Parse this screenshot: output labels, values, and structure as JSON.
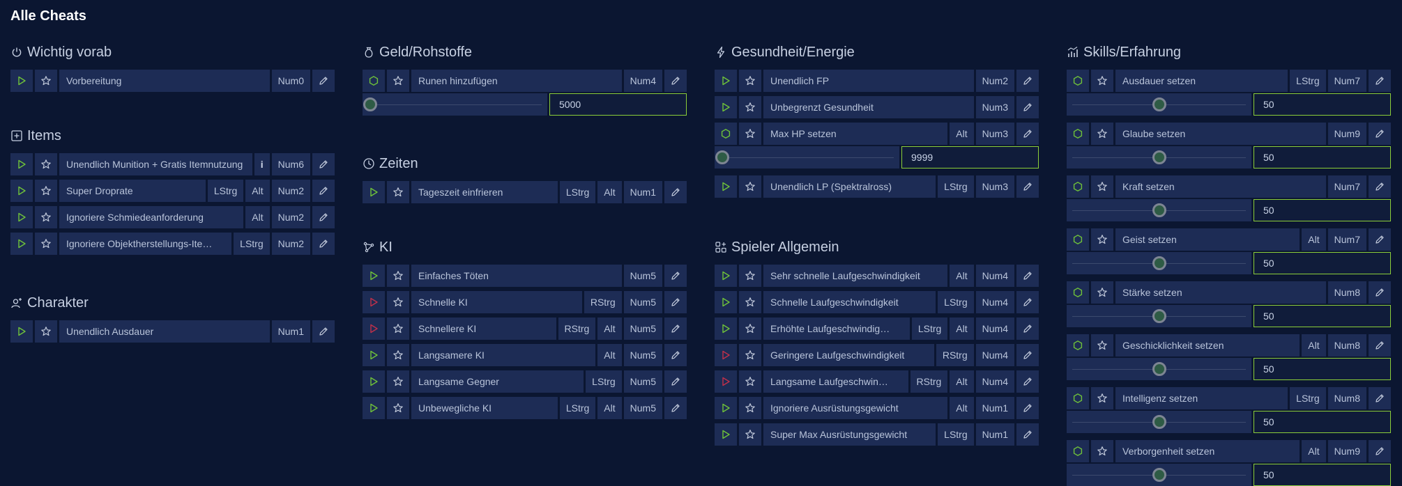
{
  "page_title": "Alle Cheats",
  "colors": {
    "background": "#0b1631",
    "cell": "#1d2c55",
    "play_green": "#6fc23a",
    "play_red": "#c0304a",
    "value_border": "#8ccf3a"
  },
  "sections": {
    "wichtig": {
      "title": "Wichtig vorab",
      "icon": "power-icon",
      "rows": [
        {
          "type": "play",
          "color": "green",
          "name": "Vorbereitung",
          "keys": [
            "Num0"
          ],
          "info": false
        }
      ]
    },
    "items": {
      "title": "Items",
      "icon": "plus-box-icon",
      "rows": [
        {
          "type": "play",
          "color": "green",
          "name": "Unendlich Munition + Gratis Itemnutzung",
          "keys": [
            "Num6"
          ],
          "info": true
        },
        {
          "type": "play",
          "color": "green",
          "name": "Super Droprate",
          "keys": [
            "LStrg",
            "Alt",
            "Num2"
          ],
          "info": false
        },
        {
          "type": "play",
          "color": "green",
          "name": "Ignoriere Schmiedeanforderung",
          "keys": [
            "Alt",
            "Num2"
          ],
          "info": false
        },
        {
          "type": "play",
          "color": "green",
          "name": "Ignoriere Objektherstellungs-Ite…",
          "keys": [
            "LStrg",
            "Num2"
          ],
          "info": false
        }
      ]
    },
    "charakter": {
      "title": "Charakter",
      "icon": "person-add-icon",
      "rows": [
        {
          "type": "play",
          "color": "green",
          "name": "Unendlich Ausdauer",
          "keys": [
            "Num1"
          ],
          "info": false
        }
      ]
    },
    "geld": {
      "title": "Geld/Rohstoffe",
      "icon": "money-bag-icon",
      "rows": [
        {
          "type": "hex",
          "name": "Runen hinzufügen",
          "keys": [
            "Num4"
          ],
          "info": false,
          "value": "5000",
          "slider_fraction": 0.0
        }
      ]
    },
    "zeiten": {
      "title": "Zeiten",
      "icon": "clock-icon",
      "rows": [
        {
          "type": "play",
          "color": "green",
          "name": "Tageszeit einfrieren",
          "keys": [
            "LStrg",
            "Alt",
            "Num1"
          ],
          "info": false
        }
      ]
    },
    "ki": {
      "title": "KI",
      "icon": "ai-network-icon",
      "rows": [
        {
          "type": "play",
          "color": "green",
          "name": "Einfaches Töten",
          "keys": [
            "Num5"
          ],
          "info": false
        },
        {
          "type": "play",
          "color": "red",
          "name": "Schnelle KI",
          "keys": [
            "RStrg",
            "Num5"
          ],
          "info": false
        },
        {
          "type": "play",
          "color": "red",
          "name": "Schnellere KI",
          "keys": [
            "RStrg",
            "Alt",
            "Num5"
          ],
          "info": false
        },
        {
          "type": "play",
          "color": "green",
          "name": "Langsamere KI",
          "keys": [
            "Alt",
            "Num5"
          ],
          "info": false
        },
        {
          "type": "play",
          "color": "green",
          "name": "Langsame Gegner",
          "keys": [
            "LStrg",
            "Num5"
          ],
          "info": false
        },
        {
          "type": "play",
          "color": "green",
          "name": "Unbewegliche KI",
          "keys": [
            "LStrg",
            "Alt",
            "Num5"
          ],
          "info": false
        }
      ]
    },
    "gesundheit": {
      "title": "Gesundheit/Energie",
      "icon": "lightning-icon",
      "rows": [
        {
          "type": "play",
          "color": "green",
          "name": "Unendlich FP",
          "keys": [
            "Num2"
          ],
          "info": false
        },
        {
          "type": "play",
          "color": "green",
          "name": "Unbegrenzt Gesundheit",
          "keys": [
            "Num3"
          ],
          "info": false
        },
        {
          "type": "hex",
          "name": "Max HP setzen",
          "keys": [
            "Alt",
            "Num3"
          ],
          "info": false,
          "value": "9999",
          "slider_fraction": 0.0
        },
        {
          "type": "play",
          "color": "green",
          "name": "Unendlich LP (Spektralross)",
          "keys": [
            "LStrg",
            "Num3"
          ],
          "info": false
        }
      ]
    },
    "spieler": {
      "title": "Spieler Allgemein",
      "icon": "apps-add-icon",
      "rows": [
        {
          "type": "play",
          "color": "green",
          "name": "Sehr schnelle Laufgeschwindigkeit",
          "keys": [
            "Alt",
            "Num4"
          ],
          "info": false
        },
        {
          "type": "play",
          "color": "green",
          "name": "Schnelle Laufgeschwindigkeit",
          "keys": [
            "LStrg",
            "Num4"
          ],
          "info": false
        },
        {
          "type": "play",
          "color": "green",
          "name": "Erhöhte Laufgeschwindig…",
          "keys": [
            "LStrg",
            "Alt",
            "Num4"
          ],
          "info": false
        },
        {
          "type": "play",
          "color": "red",
          "name": "Geringere Laufgeschwindigkeit",
          "keys": [
            "RStrg",
            "Num4"
          ],
          "info": false
        },
        {
          "type": "play",
          "color": "red",
          "name": "Langsame Laufgeschwin…",
          "keys": [
            "RStrg",
            "Alt",
            "Num4"
          ],
          "info": false
        },
        {
          "type": "play",
          "color": "green",
          "name": "Ignoriere Ausrüstungsgewicht",
          "keys": [
            "Alt",
            "Num1"
          ],
          "info": false
        },
        {
          "type": "play",
          "color": "green",
          "name": "Super Max Ausrüstungsgewicht",
          "keys": [
            "LStrg",
            "Num1"
          ],
          "info": false
        }
      ]
    },
    "skills": {
      "title": "Skills/Erfahrung",
      "icon": "chart-bars-icon",
      "rows": [
        {
          "type": "hex",
          "name": "Ausdauer setzen",
          "keys": [
            "LStrg",
            "Num7"
          ],
          "info": false,
          "value": "50",
          "slider_fraction": 0.5
        },
        {
          "type": "hex",
          "name": "Glaube setzen",
          "keys": [
            "Num9"
          ],
          "info": false,
          "value": "50",
          "slider_fraction": 0.5
        },
        {
          "type": "hex",
          "name": "Kraft setzen",
          "keys": [
            "Num7"
          ],
          "info": false,
          "value": "50",
          "slider_fraction": 0.5
        },
        {
          "type": "hex",
          "name": "Geist setzen",
          "keys": [
            "Alt",
            "Num7"
          ],
          "info": false,
          "value": "50",
          "slider_fraction": 0.5
        },
        {
          "type": "hex",
          "name": "Stärke setzen",
          "keys": [
            "Num8"
          ],
          "info": false,
          "value": "50",
          "slider_fraction": 0.5
        },
        {
          "type": "hex",
          "name": "Geschicklichkeit setzen",
          "keys": [
            "Alt",
            "Num8"
          ],
          "info": false,
          "value": "50",
          "slider_fraction": 0.5
        },
        {
          "type": "hex",
          "name": "Intelligenz setzen",
          "keys": [
            "LStrg",
            "Num8"
          ],
          "info": false,
          "value": "50",
          "slider_fraction": 0.5
        },
        {
          "type": "hex",
          "name": "Verborgenheit setzen",
          "keys": [
            "Alt",
            "Num9"
          ],
          "info": false,
          "value": "50",
          "slider_fraction": 0.5
        }
      ]
    }
  }
}
